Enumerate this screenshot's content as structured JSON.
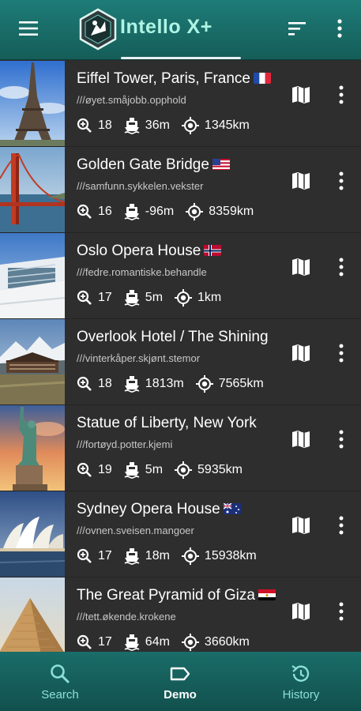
{
  "app": {
    "title": "Intello X+"
  },
  "places": [
    {
      "name": "Eiffel Tower, Paris, France",
      "w3w": "///øyet.småjobb.opphold",
      "zoom": "18",
      "elevation": "36m",
      "distance": "1345km",
      "flag": "france"
    },
    {
      "name": "Golden Gate Bridge",
      "w3w": "///samfunn.sykkelen.vekster",
      "zoom": "16",
      "elevation": "-96m",
      "distance": "8359km",
      "flag": "usa"
    },
    {
      "name": "Oslo Opera House",
      "w3w": "///fedre.romantiske.behandle",
      "zoom": "17",
      "elevation": "5m",
      "distance": "1km",
      "flag": "norway"
    },
    {
      "name": "Overlook Hotel / The Shining",
      "w3w": "///vinterkåper.skjønt.stemor",
      "zoom": "18",
      "elevation": "1813m",
      "distance": "7565km",
      "flag": ""
    },
    {
      "name": "Statue of Liberty, New York",
      "w3w": "///fortøyd.potter.kjemi",
      "zoom": "19",
      "elevation": "5m",
      "distance": "5935km",
      "flag": ""
    },
    {
      "name": "Sydney Opera House",
      "w3w": "///ovnen.sveisen.mangoer",
      "zoom": "17",
      "elevation": "18m",
      "distance": "15938km",
      "flag": "australia"
    },
    {
      "name": "The Great Pyramid of Giza",
      "w3w": "///tett.økende.krokene",
      "zoom": "17",
      "elevation": "64m",
      "distance": "3660km",
      "flag": "egypt"
    }
  ],
  "bottom_nav": {
    "search": "Search",
    "demo": "Demo",
    "history": "History"
  },
  "colors": {
    "appbar": "#1e7c77",
    "title": "#aef4e4",
    "nav_inactive": "#8be0d8"
  },
  "icons": {
    "zoom": "magnifier-plus-icon",
    "elevation": "boat-icon",
    "distance": "gps-target-icon",
    "map": "map-icon",
    "more": "more-vert-icon"
  }
}
